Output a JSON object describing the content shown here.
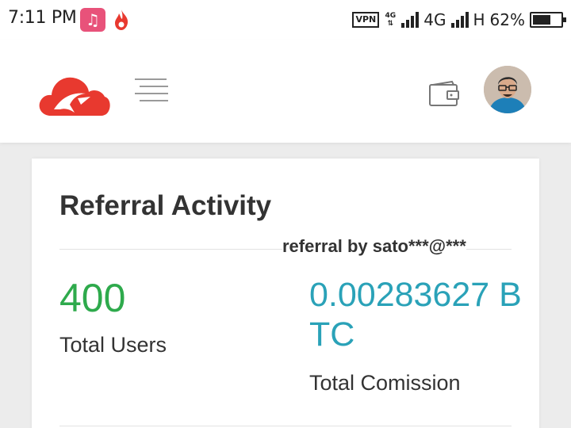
{
  "status_bar": {
    "time": "7:11 PM",
    "vpn": "VPN",
    "network_small": "4G",
    "network_1": "4G",
    "network_2": "H",
    "battery": "62%"
  },
  "header": {
    "logo_icon": "cloud-logo-icon",
    "menu_icon": "hamburger-menu-icon",
    "wallet_icon": "wallet-icon",
    "avatar_icon": "user-avatar"
  },
  "card": {
    "title": "Referral Activity",
    "referral_by": "referral by sato***@***",
    "total_users_value": "400",
    "total_users_label": "Total Users",
    "commission_value": "0.00283627 BTC",
    "commission_label": "Total Comission"
  },
  "colors": {
    "users_green": "#2eaa4c",
    "commission_teal": "#2aa2b8",
    "logo_red": "#e8392f"
  }
}
